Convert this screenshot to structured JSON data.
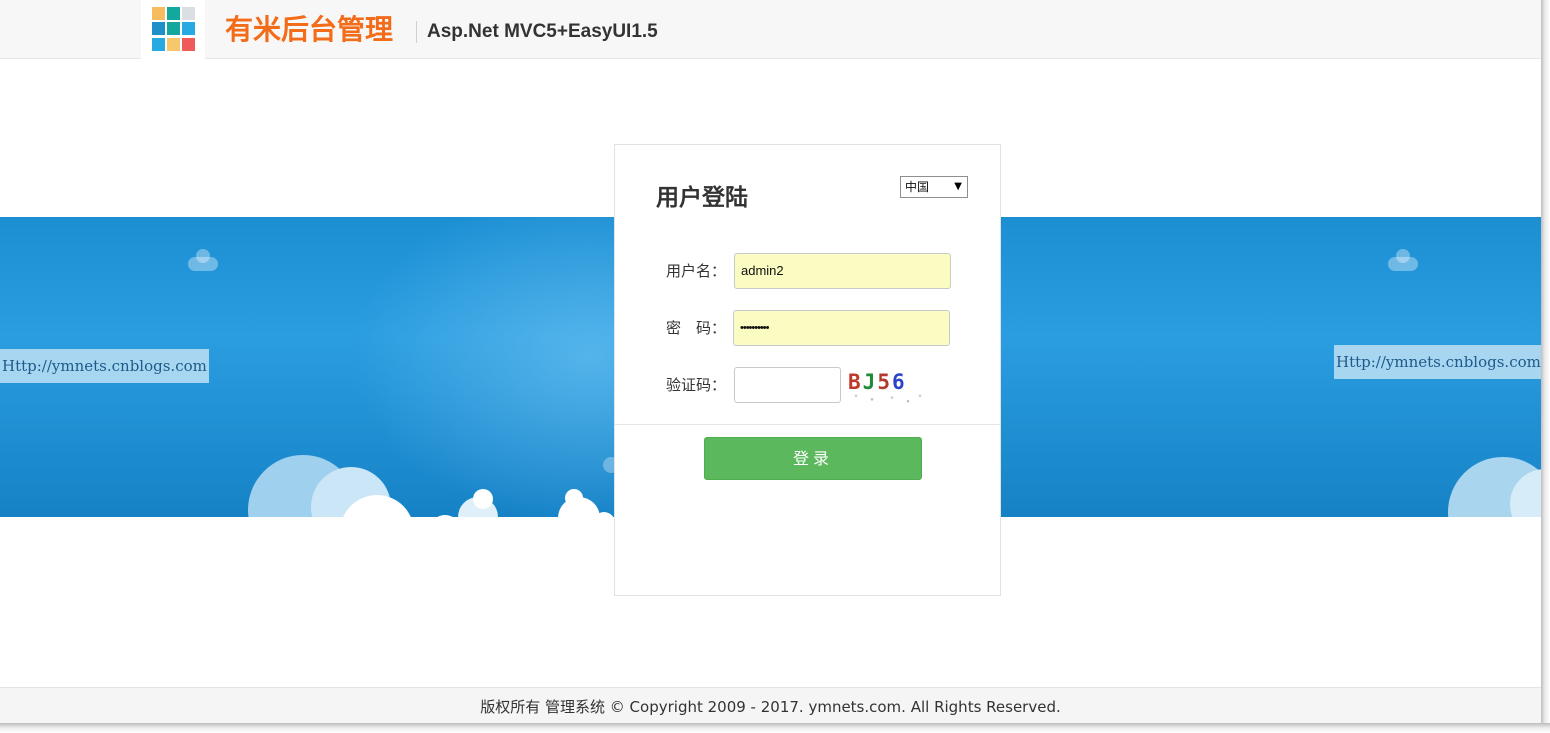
{
  "header": {
    "title": "有米后台管理",
    "subtitle": "Asp.Net MVC5+EasyUI1.5",
    "logo_colors": [
      "#f6bd60",
      "#13a89e",
      "#dadfe3",
      "#1e8fc9",
      "#13a89e",
      "#27aae1",
      "#27aae1",
      "#f6c86b",
      "#ef5b5b"
    ]
  },
  "banner": {
    "left_url": "Http://ymnets.cnblogs.com",
    "right_url": "Http://ymnets.cnblogs.com"
  },
  "login": {
    "title": "用户登陆",
    "language": "中国",
    "username_label": "用户名：",
    "username_value": "admin2",
    "password_label": "密　码：",
    "password_value": "••••••••••",
    "captcha_label": "验证码：",
    "captcha_value": "",
    "captcha_chars": [
      {
        "char": "B",
        "color": "#c0392b"
      },
      {
        "char": "J",
        "color": "#1e8a3a"
      },
      {
        "char": "5",
        "color": "#b03a2e"
      },
      {
        "char": "6",
        "color": "#2a44c8"
      }
    ],
    "submit_label": "登录"
  },
  "footer": {
    "copyright": "版权所有 管理系统 © Copyright 2009 - 2017. ymnets.com. All Rights Reserved."
  }
}
